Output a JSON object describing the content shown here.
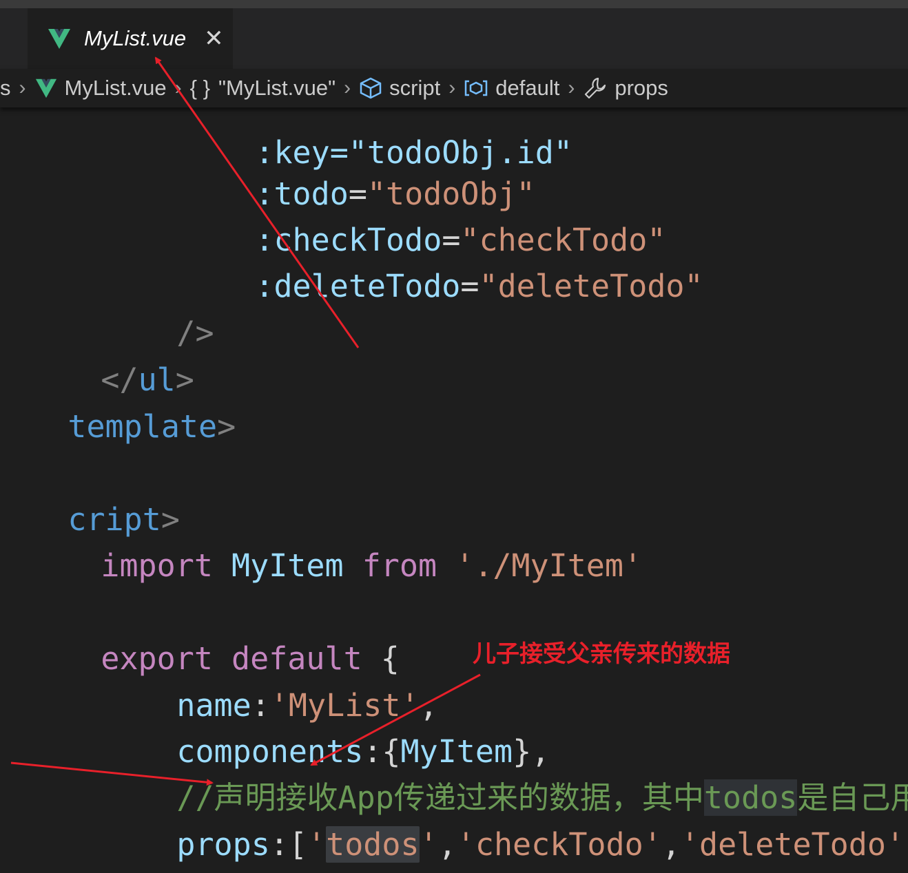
{
  "tab": {
    "file_name": "MyList.vue",
    "close_glyph": "✕",
    "icon": "vue-icon"
  },
  "breadcrumb": {
    "lead": "s",
    "items": [
      {
        "label": "MyList.vue",
        "icon": "vue-icon"
      },
      {
        "label": "\"MyList.vue\"",
        "icon": "braces-icon",
        "icon_text": "{ }"
      },
      {
        "label": "script",
        "icon": "cube-icon"
      },
      {
        "label": "default",
        "icon": "module-icon"
      },
      {
        "label": "props",
        "icon": "wrench-icon"
      }
    ]
  },
  "code": {
    "partial_top": ":key=\"todoObj.id\"",
    "l1_attr": ":todo",
    "l1_eq": "=",
    "l1_val": "\"todoObj\"",
    "l2_attr": ":checkTodo",
    "l2_eq": "=",
    "l2_val": "\"checkTodo\"",
    "l3_attr": ":deleteTodo",
    "l3_eq": "=",
    "l3_val": "\"deleteTodo\"",
    "l4": "/>",
    "l5_open": "</",
    "l5_tag": "ul",
    "l5_close": ">",
    "l6_tag": "template",
    "l6_close": ">",
    "l7_tag": "cript",
    "l7_close": ">",
    "l8_kw1": "import",
    "l8_name": "MyItem",
    "l8_kw2": "from",
    "l8_str": "'./MyItem'",
    "l9_kw1": "export",
    "l9_kw2": "default",
    "l9_brace": "{",
    "l10_key": "name",
    "l10_colon": ":",
    "l10_str": "'MyList'",
    "l10_comma": ",",
    "l11_key": "components",
    "l11_colon": ":{",
    "l11_name": "MyItem",
    "l11_end": "},",
    "l12_cmt1": "//声明接收App传递过来的数据，其中",
    "l12_hl": "todos",
    "l12_cmt2": "是自己用",
    "l13_key": "props",
    "l13_colon": ":[",
    "l13_q1": "'",
    "l13_hl": "todos",
    "l13_q2": "'",
    "l13_c1": ",",
    "l13_s2": "'checkTodo'",
    "l13_c2": ",",
    "l13_s3": "'deleteTodo'",
    "l13_end": "]",
    "l14": "}"
  },
  "annotation": {
    "text": "儿子接受父亲传来的数据",
    "color": "#e8202a"
  },
  "colors": {
    "background": "#1e1e1e",
    "attribute": "#9cdcfe",
    "string": "#ce9178",
    "keyword": "#c586c0",
    "tag": "#569cd6",
    "comment": "#6a9955",
    "vue_green": "#41b883"
  }
}
